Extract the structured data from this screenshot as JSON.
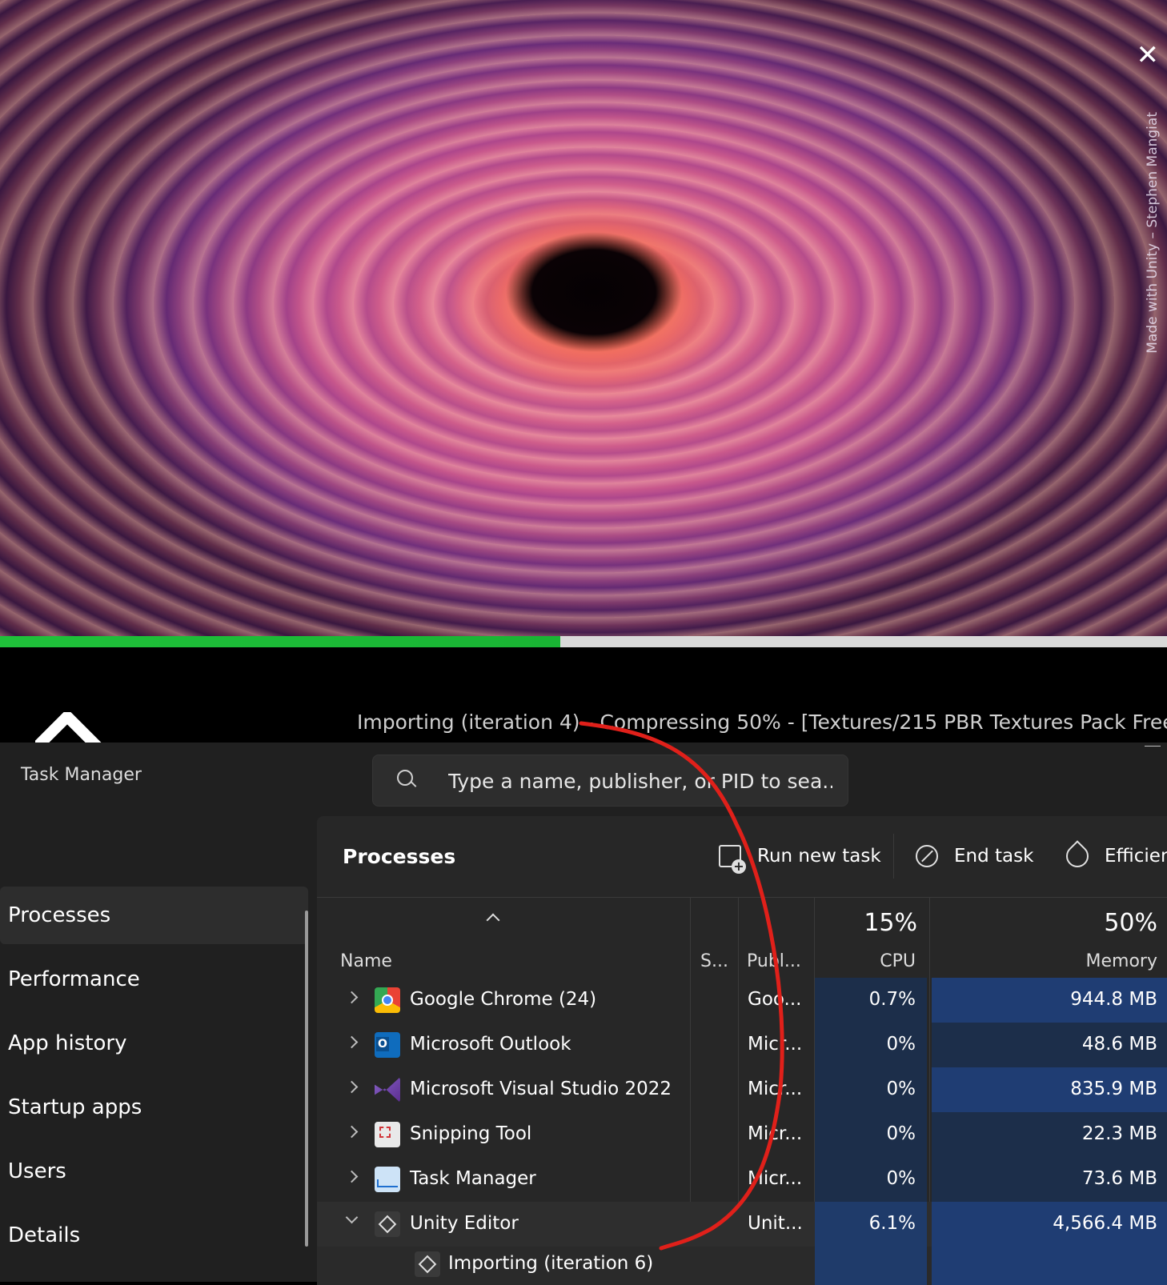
{
  "splash": {
    "credit": "Made with Unity – Stephen Mangiat",
    "close_glyph": "✕",
    "progress_fraction": 0.48,
    "status_text": "Importing (iteration 4) - Compressing 50% - [Textures/215 PBR Textures Pack Free..."
  },
  "task_manager": {
    "title": "Task Manager",
    "search_placeholder": "Type a name, publisher, or PID to sea...",
    "nav": [
      {
        "label": "Processes",
        "icon": "processes-icon"
      },
      {
        "label": "Performance",
        "icon": "performance-icon"
      },
      {
        "label": "App history",
        "icon": "app-history-icon"
      },
      {
        "label": "Startup apps",
        "icon": "startup-apps-icon"
      },
      {
        "label": "Users",
        "icon": "users-icon"
      },
      {
        "label": "Details",
        "icon": "details-icon"
      }
    ],
    "processes_title": "Processes",
    "toolbar": {
      "run_new_task": "Run new task",
      "end_task": "End task",
      "efficiency": "Efficien"
    },
    "columns": {
      "name": "Name",
      "status": "S...",
      "publisher": "Publ...",
      "cpu_total": "15%",
      "cpu": "CPU",
      "memory_total": "50%",
      "memory": "Memory"
    },
    "rows": [
      {
        "name": "Google Chrome (24)",
        "publisher": "Goo...",
        "cpu": "0.7%",
        "memory": "944.8 MB",
        "icon": "chrome-icon"
      },
      {
        "name": "Microsoft Outlook",
        "publisher": "Micr...",
        "cpu": "0%",
        "memory": "48.6 MB",
        "icon": "outlook-icon"
      },
      {
        "name": "Microsoft Visual Studio 2022",
        "publisher": "Micr...",
        "cpu": "0%",
        "memory": "835.9 MB",
        "icon": "visual-studio-icon"
      },
      {
        "name": "Snipping Tool",
        "publisher": "Micr...",
        "cpu": "0%",
        "memory": "22.3 MB",
        "icon": "snipping-tool-icon"
      },
      {
        "name": "Task Manager",
        "publisher": "Micr...",
        "cpu": "0%",
        "memory": "73.6 MB",
        "icon": "task-manager-icon"
      },
      {
        "name": "Unity Editor",
        "publisher": "Unit...",
        "cpu": "6.1%",
        "memory": "4,566.4 MB",
        "icon": "unity-icon"
      }
    ],
    "child_row": {
      "name": "Importing (iteration 6)",
      "icon": "unity-icon"
    }
  }
}
